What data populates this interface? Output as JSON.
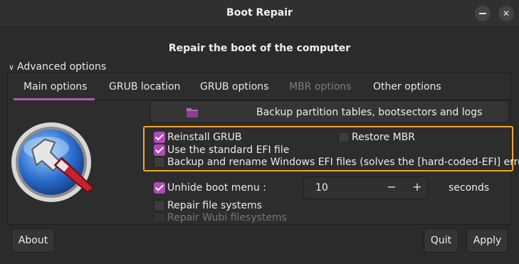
{
  "window": {
    "title": "Boot Repair",
    "minimize_icon": "minimize-icon",
    "close_glyph": "✕"
  },
  "subtitle": "Repair the boot of the computer",
  "advanced": {
    "chevron": "∨",
    "label": "Advanced options"
  },
  "tabs": [
    {
      "label": "Main options",
      "selected": true,
      "enabled": true
    },
    {
      "label": "GRUB location",
      "selected": false,
      "enabled": true
    },
    {
      "label": "GRUB options",
      "selected": false,
      "enabled": true
    },
    {
      "label": "MBR options",
      "selected": false,
      "enabled": false
    },
    {
      "label": "Other options",
      "selected": false,
      "enabled": true
    }
  ],
  "backup_button": {
    "label": "Backup partition tables, bootsectors and logs",
    "icon": "folder-icon"
  },
  "options": {
    "reinstall_grub": {
      "label": "Reinstall GRUB",
      "checked": true
    },
    "restore_mbr": {
      "label": "Restore MBR",
      "checked": false
    },
    "use_standard_efi": {
      "label": "Use the standard EFI file",
      "checked": true
    },
    "backup_rename_efi": {
      "label": "Backup and rename Windows EFI files (solves the [hard-coded-EFI] error)",
      "checked": false
    },
    "unhide_boot_menu": {
      "label": "Unhide boot menu :",
      "checked": true
    },
    "repair_fs": {
      "label": "Repair file systems",
      "checked": false
    },
    "repair_wubi": {
      "label": "Repair Wubi filesystems",
      "checked": false,
      "enabled": false
    }
  },
  "spin": {
    "value": "10",
    "minus": "−",
    "plus": "+",
    "unit": "seconds"
  },
  "buttons": {
    "about": "About",
    "quit": "Quit",
    "apply": "Apply"
  },
  "colors": {
    "accent": "#b248b8",
    "highlight": "#f5a623"
  }
}
